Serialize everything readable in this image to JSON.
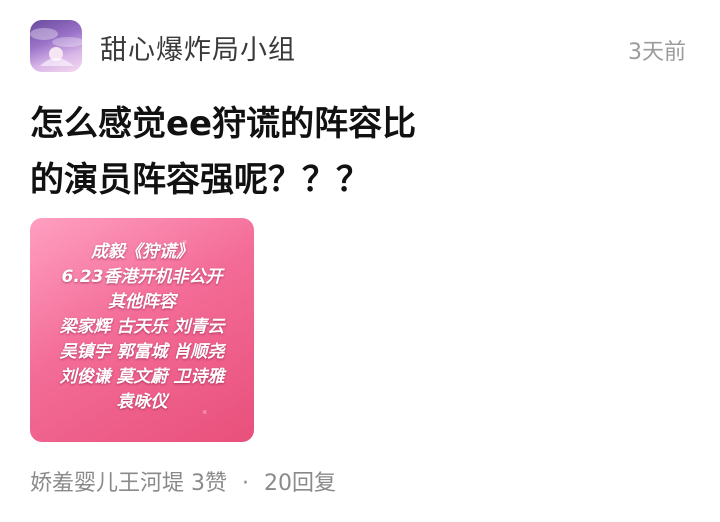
{
  "post": {
    "group_name": "甜心爆炸局小组",
    "time": "3天前",
    "title_line1": "怎么感觉ee狩谎的阵容比",
    "title_line2": "的演员阵容强呢？？？",
    "footer": {
      "author": "娇羞婴儿王河堤",
      "likes": "3赞",
      "separator": "·",
      "replies": "20回复"
    }
  },
  "card": {
    "lines": [
      "成毅《狩谎》",
      "6.23香港开机非公开",
      "其他阵容",
      "梁家辉  古天乐  刘青云",
      "吴镇宇  郭富城  肖顺尧",
      "刘俊谦  莫文蔚  卫诗雅",
      "袁咏仪"
    ],
    "gradient_colors": [
      "#ff9fc1",
      "#f36c97",
      "#e8507b"
    ]
  },
  "icons": {
    "avatar": "group-avatar-image"
  }
}
